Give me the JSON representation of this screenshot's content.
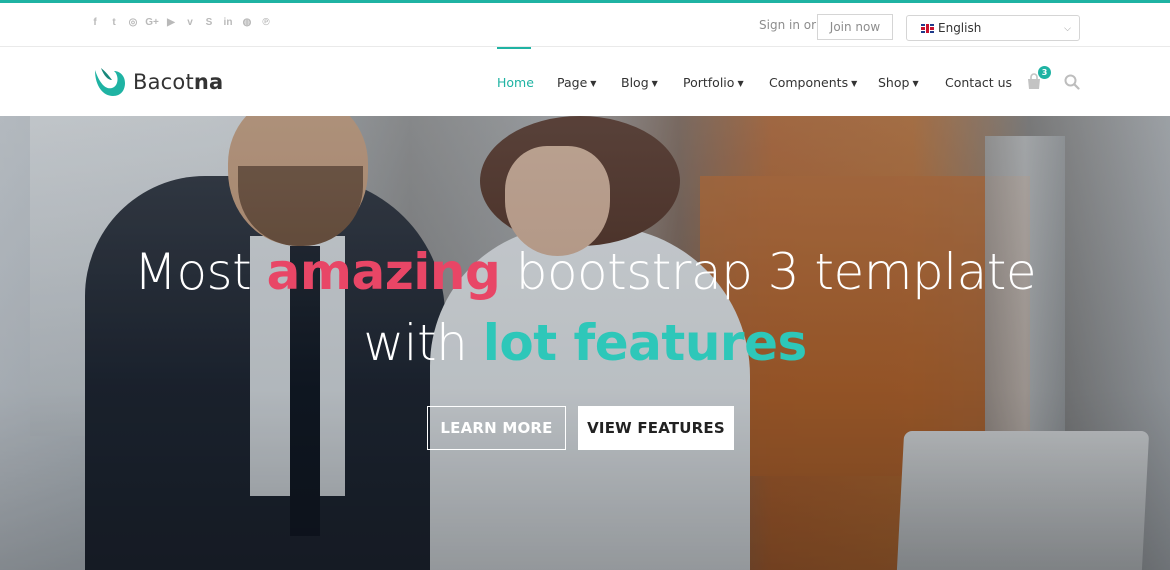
{
  "topbar": {
    "social_icons": [
      "facebook-icon",
      "twitter-icon",
      "instagram-icon",
      "google-plus-icon",
      "youtube-icon",
      "vimeo-icon",
      "skype-icon",
      "linkedin-icon",
      "dribbble-icon",
      "pinterest-icon"
    ],
    "social_glyphs": [
      "f",
      "t",
      "◎",
      "G+",
      "▶",
      "v",
      "S",
      "in",
      "◍",
      "℗"
    ],
    "signin_text": "Sign in or",
    "join_label": "Join now",
    "language": "English"
  },
  "navbar": {
    "brand_prefix": "Bacot",
    "brand_suffix": "na",
    "items": [
      {
        "label": "Home",
        "active": true,
        "dropdown": false
      },
      {
        "label": "Page",
        "dropdown": true
      },
      {
        "label": "Blog",
        "dropdown": true
      },
      {
        "label": "Portfolio",
        "dropdown": true
      },
      {
        "label": "Components",
        "dropdown": true
      },
      {
        "label": "Shop",
        "dropdown": true
      },
      {
        "label": "Contact us",
        "dropdown": false
      }
    ],
    "cart_count": "3"
  },
  "hero": {
    "line1_a": "Most ",
    "line1_b": "amazing",
    "line1_c": " bootstrap 3 template",
    "line2_a": "with ",
    "line2_b": "lot features",
    "btn_learn": "LEARN MORE",
    "btn_features": "VIEW FEATURES"
  },
  "colors": {
    "accent": "#1fb3a3",
    "pink": "#e84666",
    "teal_text": "#2ec7b9"
  }
}
